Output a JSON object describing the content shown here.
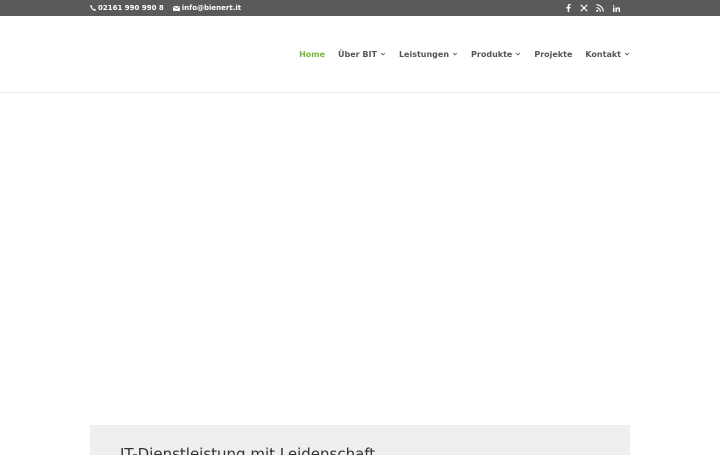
{
  "topbar": {
    "phone": "02161 990 990 8",
    "email": "info@bienert.it",
    "social": [
      {
        "icon": "facebook-icon"
      },
      {
        "icon": "x-icon"
      },
      {
        "icon": "rss-icon"
      },
      {
        "icon": "linkedin-icon"
      }
    ]
  },
  "nav": {
    "items": [
      {
        "label": "Home"
      },
      {
        "label": "Über BIT"
      },
      {
        "label": "Leistungen"
      },
      {
        "label": "Produkte"
      },
      {
        "label": "Projekte"
      },
      {
        "label": "Kontakt"
      }
    ]
  },
  "main": {
    "heading": "IT-Dienstleistung mit Leidenschaft"
  },
  "colors": {
    "topbar_bg": "#5a5a5a",
    "accent": "#7cb342",
    "nav_text": "#555555",
    "box_bg": "#efefef"
  }
}
